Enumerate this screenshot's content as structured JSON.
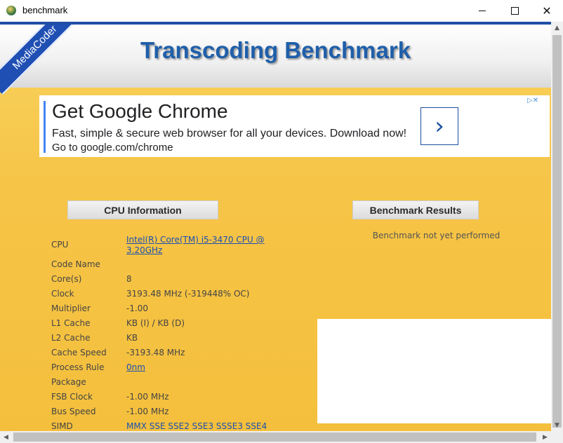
{
  "window": {
    "title": "benchmark",
    "controls": {
      "minimize": "minimize",
      "maximize": "maximize",
      "close": "✕"
    }
  },
  "header": {
    "ribbon_text": "MediaCoder",
    "title": "Transcoding Benchmark"
  },
  "ad": {
    "headline": "Get Google Chrome",
    "line1": "Fast, simple & secure web browser for all your devices. Download now!",
    "line2": "Go to google.com/chrome",
    "arrow_icon": "chevron-right-icon",
    "choices": "▷✕"
  },
  "sections": {
    "cpu_button": "CPU Information",
    "bench_button": "Benchmark Results",
    "bench_status": "Benchmark not yet performed"
  },
  "cpu_info": {
    "cpu_label": "CPU",
    "cpu_value_line1": "Intel(R) Core(TM) i5-3470 CPU @",
    "cpu_value_line2": "3.20GHz",
    "code_name_label": "Code Name",
    "code_name_value": "",
    "cores_label": "Core(s)",
    "cores_value": "8",
    "clock_label": "Clock",
    "clock_value": "3193.48 MHz (-319448% OC)",
    "multiplier_label": "Multiplier",
    "multiplier_value": "-1.00",
    "l1_label": "L1 Cache",
    "l1_value": "KB (I) / KB (D)",
    "l2_label": "L2 Cache",
    "l2_value": "KB",
    "cache_speed_label": "Cache Speed",
    "cache_speed_value": "-3193.48 MHz",
    "process_rule_label": "Process Rule",
    "process_rule_value": "0nm",
    "package_label": "Package",
    "package_value": "",
    "fsb_label": "FSB Clock",
    "fsb_value": "-1.00 MHz",
    "bus_label": "Bus Speed",
    "bus_value": "-1.00 MHz",
    "simd_label": "SIMD",
    "simd_value": "MMX SSE SSE2 SSE3 SSSE3 SSE4"
  },
  "scrollbars": {
    "up_arrow": "▲",
    "down_arrow": "▼",
    "left_arrow": "◀",
    "right_arrow": "▶"
  },
  "colors": {
    "accent_blue": "#1f4fa6",
    "page_background": "#f6c447",
    "link": "#1a4fb0"
  }
}
